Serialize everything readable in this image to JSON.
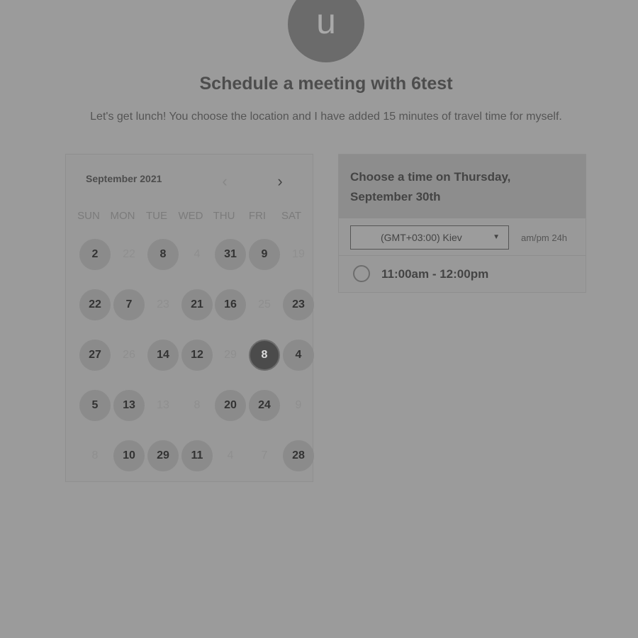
{
  "host": {
    "avatar_letter": "u",
    "title": "Schedule a meeting with 6test",
    "description": "Let's get lunch! You choose the location and I have added 15 minutes of travel time for myself."
  },
  "calendar": {
    "month": "September 2021",
    "weekdays": [
      "SUN",
      "MON",
      "TUE",
      "WED",
      "THU",
      "FRI",
      "SAT"
    ],
    "rows": [
      [
        {
          "label": "2",
          "state": "available"
        },
        {
          "label": "22",
          "state": "disabled"
        },
        {
          "label": "8",
          "state": "available"
        },
        {
          "label": "4",
          "state": "disabled"
        },
        {
          "label": "31",
          "state": "available"
        },
        {
          "label": "9",
          "state": "available"
        },
        {
          "label": "19",
          "state": "disabled"
        }
      ],
      [
        {
          "label": "22",
          "state": "available"
        },
        {
          "label": "7",
          "state": "available"
        },
        {
          "label": "23",
          "state": "disabled"
        },
        {
          "label": "21",
          "state": "available"
        },
        {
          "label": "16",
          "state": "available"
        },
        {
          "label": "25",
          "state": "disabled"
        },
        {
          "label": "23",
          "state": "available"
        }
      ],
      [
        {
          "label": "27",
          "state": "available"
        },
        {
          "label": "26",
          "state": "disabled"
        },
        {
          "label": "14",
          "state": "available"
        },
        {
          "label": "12",
          "state": "available"
        },
        {
          "label": "29",
          "state": "disabled"
        },
        {
          "label": "8",
          "state": "selected"
        },
        {
          "label": "4",
          "state": "available"
        }
      ],
      [
        {
          "label": "5",
          "state": "available"
        },
        {
          "label": "13",
          "state": "available"
        },
        {
          "label": "13",
          "state": "disabled"
        },
        {
          "label": "8",
          "state": "disabled"
        },
        {
          "label": "20",
          "state": "available"
        },
        {
          "label": "24",
          "state": "available"
        },
        {
          "label": "9",
          "state": "disabled"
        }
      ],
      [
        {
          "label": "8",
          "state": "disabled"
        },
        {
          "label": "10",
          "state": "available"
        },
        {
          "label": "29",
          "state": "available"
        },
        {
          "label": "11",
          "state": "available"
        },
        {
          "label": "4",
          "state": "disabled"
        },
        {
          "label": "7",
          "state": "disabled"
        },
        {
          "label": "28",
          "state": "available"
        }
      ]
    ]
  },
  "time_picker": {
    "heading": "Choose a time on Thursday, September 30th",
    "timezone": "(GMT+03:00) Kiev",
    "format_toggle": "am/pm  24h",
    "slots": [
      "11:00am - 12:00pm"
    ]
  },
  "icons": {
    "prev": "chevron-left-icon",
    "next": "chevron-right-icon",
    "dropdown": "caret-down-icon"
  }
}
